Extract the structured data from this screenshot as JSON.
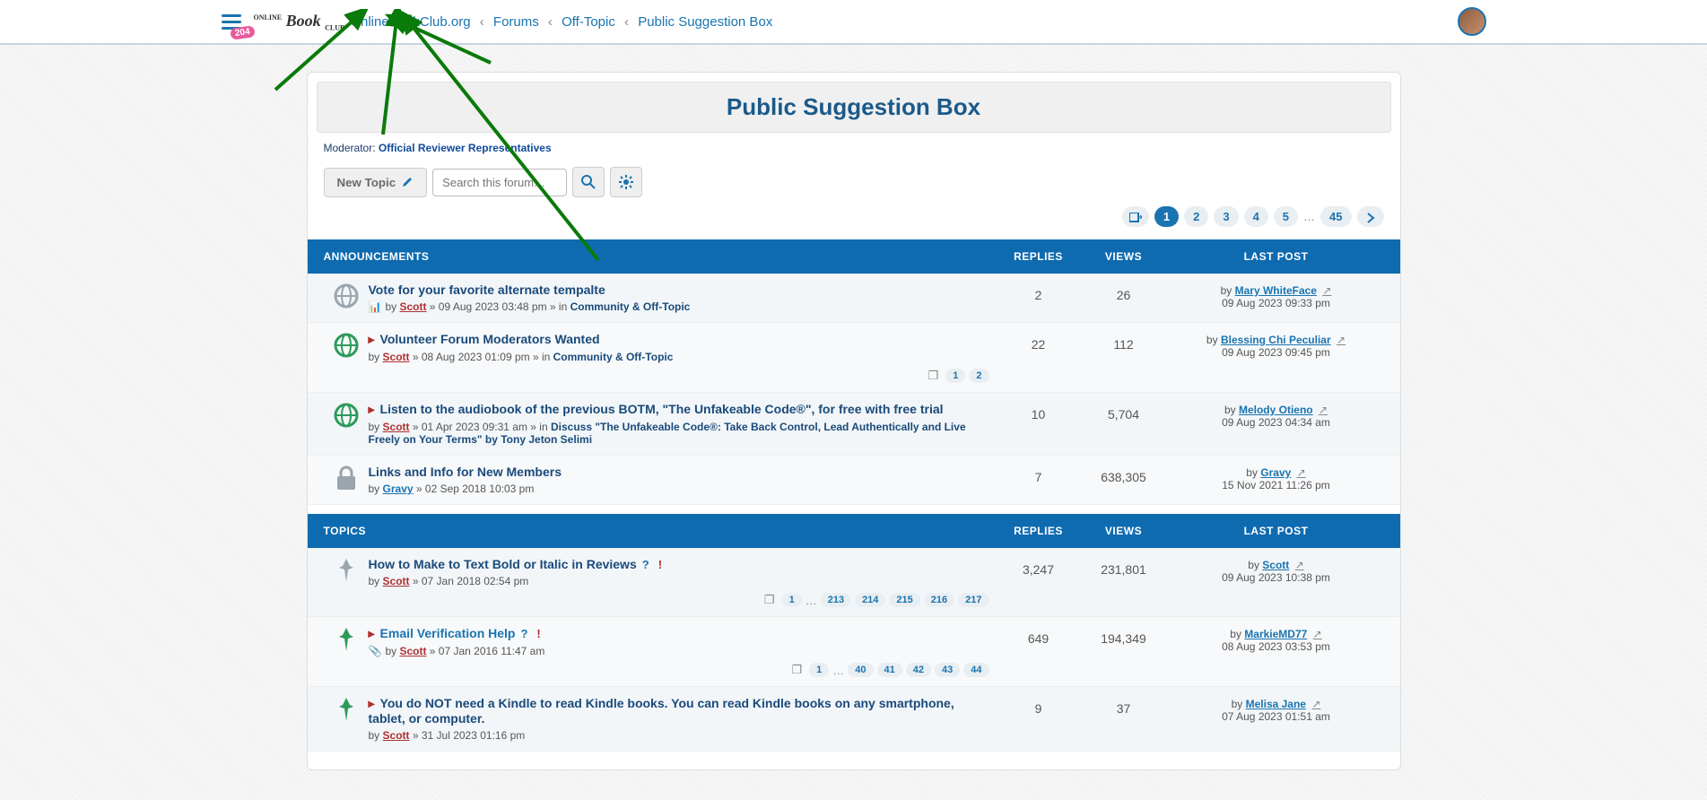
{
  "header": {
    "badge": "204",
    "logo_top": "ONLINE",
    "logo_main": "Book",
    "logo_bottom": "CLUB",
    "breadcrumbs": [
      "OnlineBookClub.org",
      "Forums",
      "Off-Topic",
      "Public Suggestion Box"
    ]
  },
  "page": {
    "title": "Public Suggestion Box",
    "moderator_label": "Moderator:",
    "moderator_link": "Official Reviewer Representatives",
    "new_topic": "New Topic",
    "search_placeholder": "Search this forum…"
  },
  "pager": {
    "pages": [
      "1",
      "2",
      "3",
      "4",
      "5"
    ],
    "ellipsis": "…",
    "last": "45"
  },
  "columns": {
    "announcements": "ANNOUNCEMENTS",
    "topics": "TOPICS",
    "replies": "REPLIES",
    "views": "VIEWS",
    "last_post": "LAST POST"
  },
  "announcements": [
    {
      "icon": "globe-grey",
      "title": "Vote for your favorite alternate tempalte",
      "title_class": "",
      "prefix_icon": "chart",
      "author": "Scott",
      "author_class": "",
      "date": "09 Aug 2023 03:48 pm",
      "in": "Community & Off-Topic",
      "replies": "2",
      "views": "26",
      "last_by": "Mary WhiteFace",
      "last_date": "09 Aug 2023 09:33 pm",
      "mini": []
    },
    {
      "icon": "globe-green",
      "unread": true,
      "title": "Volunteer Forum Moderators Wanted",
      "title_class": "",
      "author": "Scott",
      "date": "08 Aug 2023 01:09 pm",
      "in": "Community & Off-Topic",
      "replies": "22",
      "views": "112",
      "last_by": "Blessing Chi Peculiar",
      "last_date": "09 Aug 2023 09:45 pm",
      "mini": [
        "1",
        "2"
      ]
    },
    {
      "icon": "globe-green",
      "unread": true,
      "title": "Listen to the audiobook of the previous BOTM, \"The Unfakeable Code®\", for free with free trial",
      "title_class": "",
      "author": "Scott",
      "date": "01 Apr 2023 09:31 am",
      "in": "Discuss \"The Unfakeable Code®: Take Back Control, Lead Authentically and Live Freely on Your Terms\" by Tony Jeton Selimi",
      "replies": "10",
      "views": "5,704",
      "last_by": "Melody Otieno",
      "last_date": "09 Aug 2023 04:34 am",
      "mini": []
    },
    {
      "icon": "lock",
      "title": "Links and Info for New Members",
      "title_class": "",
      "author": "Gravy",
      "author_class": "blue",
      "date": "02 Sep 2018 10:03 pm",
      "in": "",
      "replies": "7",
      "views": "638,305",
      "last_by": "Gravy",
      "last_date": "15 Nov 2021 11:26 pm",
      "mini": []
    }
  ],
  "topics": [
    {
      "icon": "pin-grey",
      "title": "How to Make to Text Bold or Italic in Reviews",
      "q": true,
      "excl": true,
      "author": "Scott",
      "date": "07 Jan 2018 02:54 pm",
      "replies": "3,247",
      "views": "231,801",
      "last_by": "Scott",
      "last_date": "09 Aug 2023 10:38 pm",
      "mini": [
        "1",
        "…",
        "213",
        "214",
        "215",
        "216",
        "217"
      ]
    },
    {
      "icon": "pin-green",
      "unread": true,
      "title": "Email Verification Help",
      "title_class": "blue",
      "q": true,
      "excl": true,
      "attach": true,
      "author": "Scott",
      "date": "07 Jan 2016 11:47 am",
      "replies": "649",
      "views": "194,349",
      "last_by": "MarkieMD77",
      "last_date": "08 Aug 2023 03:53 pm",
      "mini": [
        "1",
        "…",
        "40",
        "41",
        "42",
        "43",
        "44"
      ]
    },
    {
      "icon": "pin-green",
      "unread": true,
      "title": "You do NOT need a Kindle to read Kindle books. You can read Kindle books on any smartphone, tablet, or computer.",
      "author": "Scott",
      "date": "31 Jul 2023 01:16 pm",
      "replies": "9",
      "views": "37",
      "last_by": "Melisa Jane",
      "last_date": "07 Aug 2023 01:51 am",
      "mini": []
    }
  ]
}
